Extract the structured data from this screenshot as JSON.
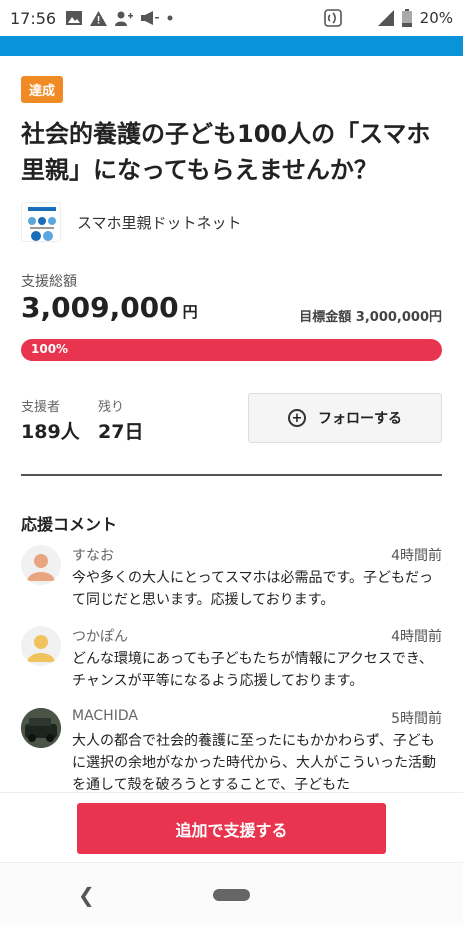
{
  "status": {
    "time": "17:56",
    "battery": "20%"
  },
  "project": {
    "badge": "達成",
    "title": "社会的養護の子ども100人の「スマホ里親」になってもらえませんか？",
    "org_name": "スマホ里親ドットネット"
  },
  "funding": {
    "total_label": "支援総額",
    "amount": "3,009,000",
    "currency": "円",
    "goal_text": "目標金額 3,000,000円",
    "progress_text": "100%",
    "progress_fraction": 1.0
  },
  "stats": {
    "supporters_label": "支援者",
    "supporters_value": "189人",
    "remaining_label": "残り",
    "remaining_value": "27日"
  },
  "follow": {
    "label": "フォローする"
  },
  "comments": {
    "section_title": "応援コメント",
    "items": [
      {
        "name": "すなお",
        "time": "4時間前",
        "text": "今や多くの大人にとってスマホは必需品です。子どもだって同じだと思います。応援しております。"
      },
      {
        "name": "つかぽん",
        "time": "4時間前",
        "text": "どんな環境にあっても子どもたちが情報にアクセスでき、チャンスが平等になるよう応援しております。"
      },
      {
        "name": "MACHIDA",
        "time": "5時間前",
        "text": "大人の都合で社会的養護に至ったにもかかわらず、子どもに選択の余地がなかった時代から、大人がこういった活動を通して殻を破ろうとすることで、子どもた"
      }
    ]
  },
  "cta": {
    "label": "追加で支援する"
  },
  "colors": {
    "accent": "#e8344e",
    "badge": "#f08a24",
    "topbar": "#0a93d8"
  }
}
